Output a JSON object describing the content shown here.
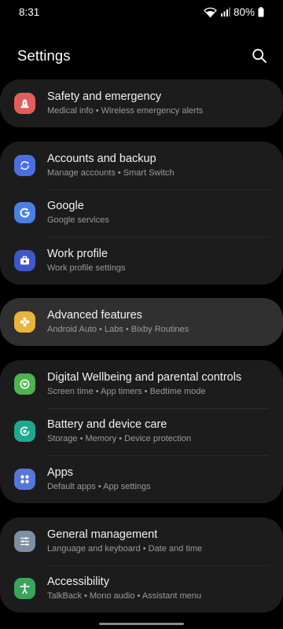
{
  "status_bar": {
    "time": "8:31",
    "battery": "80%",
    "icons": [
      "wifi-icon",
      "signal-icon",
      "battery-icon"
    ]
  },
  "header": {
    "title": "Settings",
    "search_icon": "search-icon"
  },
  "colors": {
    "background": "#000000",
    "card": "#1c1c1c",
    "card_highlight": "#303030",
    "safety_icon": "#e35d5b",
    "accounts_icon": "#4a6fe0",
    "google_icon": "#4a7fe6",
    "work_icon": "#3f57c9",
    "advanced_icon": "#e9b43a",
    "wellbeing_icon": "#4fb34f",
    "battery_icon": "#1fa88f",
    "apps_icon": "#5577d9",
    "general_icon": "#7e8ea3",
    "accessibility_icon": "#3aa45b"
  },
  "groups": [
    {
      "items": [
        {
          "name": "safety",
          "icon": "siren-icon",
          "title": "Safety and emergency",
          "subtitle": "Medical info  •  Wireless emergency alerts"
        }
      ]
    },
    {
      "items": [
        {
          "name": "accounts",
          "icon": "sync-icon",
          "title": "Accounts and backup",
          "subtitle": "Manage accounts  •  Smart Switch"
        },
        {
          "name": "google",
          "icon": "google-icon",
          "title": "Google",
          "subtitle": "Google services"
        },
        {
          "name": "work-profile",
          "icon": "briefcase-icon",
          "title": "Work profile",
          "subtitle": "Work profile settings"
        }
      ]
    },
    {
      "items": [
        {
          "name": "advanced",
          "icon": "puzzle-gear-icon",
          "title": "Advanced features",
          "subtitle": "Android Auto  •  Labs  •  Bixby Routines"
        }
      ]
    },
    {
      "items": [
        {
          "name": "wellbeing",
          "icon": "wellbeing-icon",
          "title": "Digital Wellbeing and parental controls",
          "subtitle": "Screen time  •  App timers  •  Bedtime mode"
        },
        {
          "name": "battery",
          "icon": "device-care-icon",
          "title": "Battery and device care",
          "subtitle": "Storage  •  Memory  •  Device protection"
        },
        {
          "name": "apps",
          "icon": "apps-grid-icon",
          "title": "Apps",
          "subtitle": "Default apps  •  App settings"
        }
      ]
    },
    {
      "items": [
        {
          "name": "general",
          "icon": "sliders-icon",
          "title": "General management",
          "subtitle": "Language and keyboard  •  Date and time"
        },
        {
          "name": "accessibility",
          "icon": "accessibility-icon",
          "title": "Accessibility",
          "subtitle": "TalkBack  •  Mono audio  •  Assistant menu"
        }
      ]
    }
  ]
}
